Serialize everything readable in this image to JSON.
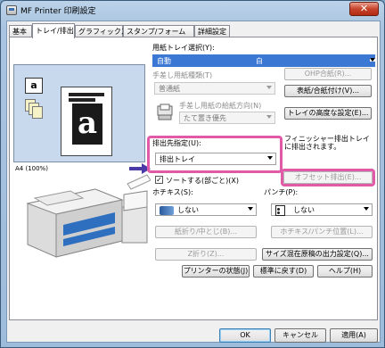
{
  "window": {
    "title": "MF Printer 印刷設定",
    "close_symbol": "✕"
  },
  "tabs": [
    {
      "label": "基本",
      "active": false
    },
    {
      "label": "トレイ/排出",
      "active": true
    },
    {
      "label": "グラフィックス",
      "active": false
    },
    {
      "label": "スタンプ/フォーム",
      "active": false
    },
    {
      "label": "詳細設定",
      "active": false
    }
  ],
  "preview": {
    "label": "A4 (100%)",
    "mini_icon_letter": "a",
    "paper_letter": "a"
  },
  "paper_source": {
    "label": "用紙トレイ選択(Y):",
    "value_left": "自動",
    "value_right": "白",
    "ohp_button": "OHP合紙(R)..."
  },
  "manual_feed": {
    "label": "手差し用紙種類(T)",
    "value": "普通紙",
    "cover_button": "表紙/合紙付け(V)..."
  },
  "manual_orientation": {
    "label": "手差し用紙の給紙方向(N)",
    "value": "たて置き優先",
    "tray_advanced_button": "トレイの高度な設定(E)..."
  },
  "output_dest": {
    "label": "排出先指定(U):",
    "value": "排出トレイ",
    "note": "フィニッシャー排出トレイに排出されます。",
    "offset_button": "オフセット排出(E)..."
  },
  "sort": {
    "label": "ソートする(部ごと)(X)",
    "checked": true
  },
  "staple": {
    "label": "ホチキス(S):",
    "value": "しない"
  },
  "punch": {
    "label": "パンチ(P):",
    "value": "しない"
  },
  "buttons": {
    "fold": "紙折り/中とじ(B)...",
    "staple_punch_position": "ホチキス/パンチ位置(L)...",
    "z_fold": "Z折り(Z)...",
    "mixed_size": "サイズ混在原稿の出力設定(Q)...",
    "printer_status": "プリンターの状態(J)",
    "restore_default": "標準に戻す(D)",
    "help": "ヘルプ(H)"
  },
  "dialog_buttons": {
    "ok": "OK",
    "cancel": "キャンセル",
    "apply": "適用(A)"
  },
  "colors": {
    "accent_highlight": "#e05aa8",
    "selected_blue": "#3b78d4"
  }
}
